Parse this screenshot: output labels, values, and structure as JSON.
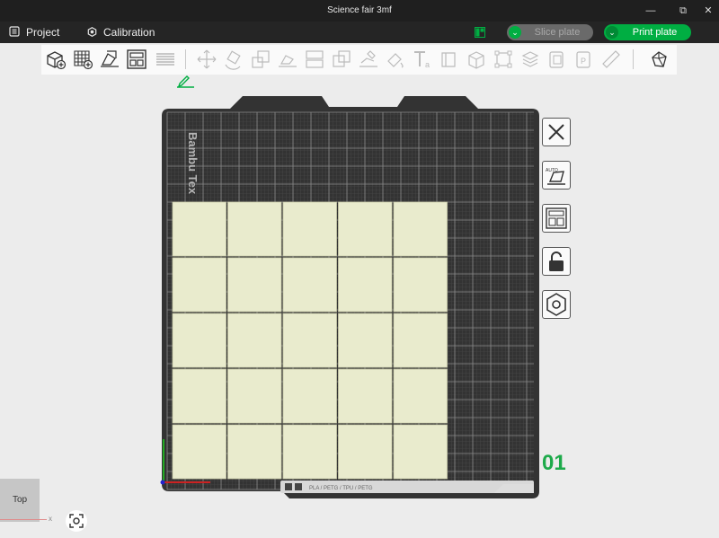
{
  "window": {
    "title": "Science fair 3mf"
  },
  "window_controls": {
    "minimize": "—",
    "restore": "⧉",
    "close": "✕"
  },
  "menu": {
    "project": {
      "label": "Project",
      "icon": "document-icon"
    },
    "calibration": {
      "label": "Calibration",
      "icon": "calibration-icon"
    }
  },
  "actions": {
    "slice_label": "Slice plate",
    "slice_enabled": false,
    "print_label": "Print plate",
    "dropdown_glyph": "⌄"
  },
  "toolbar": {
    "tools": [
      "add-object-icon",
      "add-plate-icon",
      "auto-orient-icon",
      "arrange-icon",
      "split-plates-icon",
      "move-icon",
      "rotate-icon",
      "scale-icon",
      "lay-on-face-icon",
      "cut-icon",
      "mesh-boolean-icon",
      "support-painting-icon",
      "seam-painting-icon",
      "text-emboss-icon",
      "svg-emboss-icon",
      "assembly-icon",
      "measure-icon",
      "assemble-icon",
      "layers-icon",
      "variable-layer-icon",
      "paint-icon",
      "ruler-icon",
      "explode-icon"
    ]
  },
  "bed": {
    "brand_text": "Bambu Tex",
    "label_strip": "PLA / PETG / TPU / PETG",
    "grid": {
      "cols": 5,
      "rows": 5
    }
  },
  "plate": {
    "number": "01"
  },
  "side_tools": [
    "close-plate-icon",
    "auto-orient-plate-icon",
    "arrange-plate-icon",
    "lock-plate-icon",
    "plate-settings-icon"
  ],
  "view": {
    "label": "Top",
    "axis": "x"
  },
  "colors": {
    "accent": "#00ae42",
    "bed": "#3a3a3a",
    "tile": "#e9ebcd",
    "plate_number": "#1daa4a"
  }
}
